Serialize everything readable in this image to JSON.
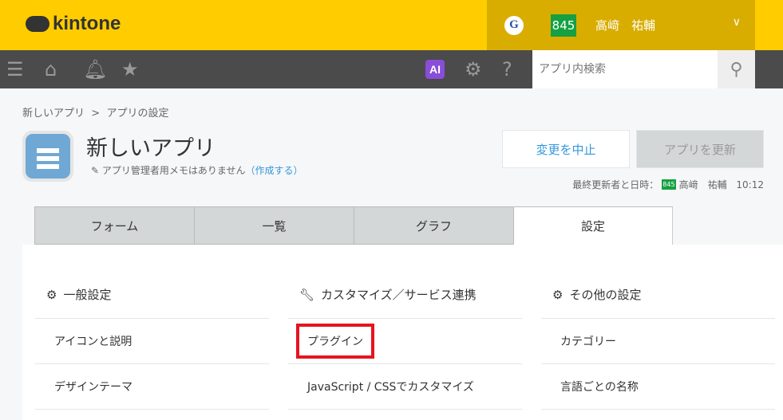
{
  "header": {
    "logo": "kintone",
    "g_label": "G",
    "user_badge": "845",
    "user_name": "高﨑　祐輔"
  },
  "nav": {
    "ai_label": "AI",
    "search_placeholder": "アプリ内検索"
  },
  "breadcrumb": {
    "app": "新しいアプリ",
    "sep": ">",
    "current": "アプリの設定"
  },
  "app": {
    "title": "新しいアプリ",
    "memo": "アプリ管理者用メモはありません",
    "memo_link": "（作成する）"
  },
  "buttons": {
    "cancel": "変更を中止",
    "update": "アプリを更新"
  },
  "last_updated": {
    "label": "最終更新者と日時：",
    "badge": "845",
    "user": "高﨑　祐輔",
    "time": "10:12"
  },
  "tabs": [
    "フォーム",
    "一覧",
    "グラフ",
    "設定"
  ],
  "sections": [
    {
      "title": "一般設定",
      "items": [
        "アイコンと説明",
        "デザインテーマ"
      ]
    },
    {
      "title": "カスタマイズ／サービス連携",
      "items": [
        "プラグイン",
        "JavaScript / CSSでカスタマイズ"
      ]
    },
    {
      "title": "その他の設定",
      "items": [
        "カテゴリー",
        "言語ごとの名称"
      ]
    }
  ]
}
